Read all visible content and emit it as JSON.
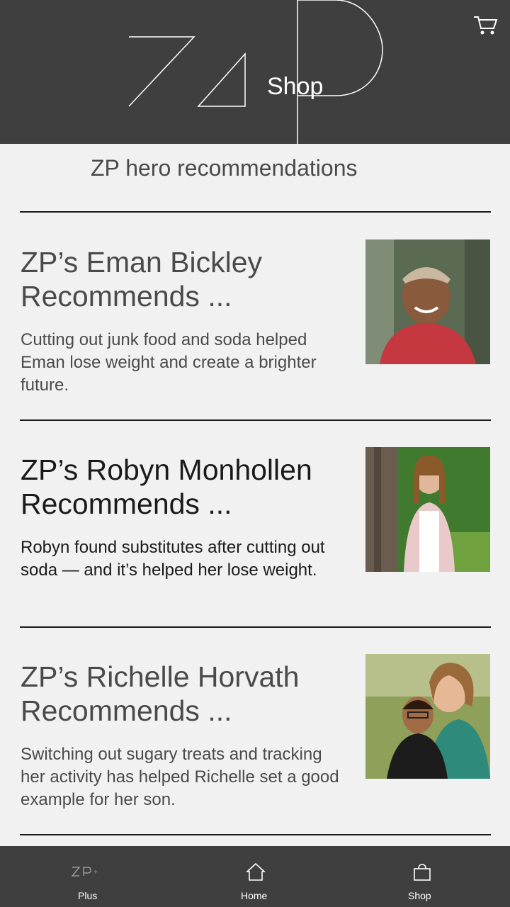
{
  "header": {
    "logo_alt": "ZP",
    "shop_label": "Shop",
    "cart_icon": "shopping-cart-icon"
  },
  "subtitle": "ZP hero recommendations",
  "cards": [
    {
      "title": "ZP’s Eman Bickley Recommends ...",
      "description": "Cutting out junk food and soda helped Eman lose weight and create a brighter future.",
      "photo": "portrait-eman"
    },
    {
      "title": "ZP’s Robyn Monhollen Recommends ...",
      "description": "Robyn found substitutes after cutting out soda — and it’s helped her lose weight.",
      "photo": "portrait-robyn"
    },
    {
      "title": "ZP’s Richelle Horvath Recommends ...",
      "description": "Switching out sugary treats and tracking her activity has helped Richelle set a good example for her son.",
      "photo": "portrait-richelle"
    }
  ],
  "bottom_nav": {
    "items": [
      {
        "label": "Plus",
        "icon": "zp-plus-logo-icon"
      },
      {
        "label": "Home",
        "icon": "home-icon"
      },
      {
        "label": "Shop",
        "icon": "shop-bag-icon"
      }
    ]
  },
  "colors": {
    "header_bg": "#3f3f3f",
    "page_bg": "#f1f1f1",
    "text": "#4a4a4a",
    "rule": "#1a1a1a"
  }
}
